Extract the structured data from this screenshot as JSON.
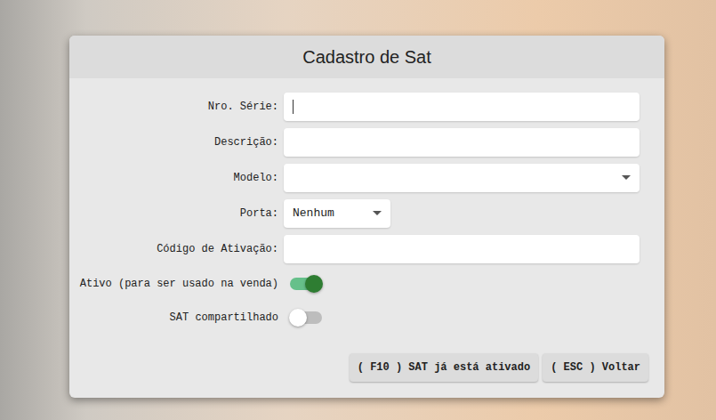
{
  "dialog": {
    "title": "Cadastro de Sat"
  },
  "fields": [
    {
      "label": "Nro. Série:",
      "kind": "text",
      "value": "",
      "focused": true
    },
    {
      "label": "Descrição:",
      "kind": "text",
      "value": "",
      "focused": false
    },
    {
      "label": "Modelo:",
      "kind": "select",
      "value": "",
      "focused": false
    },
    {
      "label": "Porta:",
      "kind": "select-small",
      "value": "Nenhum",
      "focused": false
    },
    {
      "label": "Código de Ativação:",
      "kind": "text",
      "value": "",
      "focused": false
    }
  ],
  "toggles": [
    {
      "label": "Ativo (para ser usado na venda)",
      "on": true
    },
    {
      "label": "SAT compartilhado",
      "on": false
    }
  ],
  "buttons": [
    "( F10 ) SAT já está ativado",
    "( ESC ) Voltar"
  ]
}
